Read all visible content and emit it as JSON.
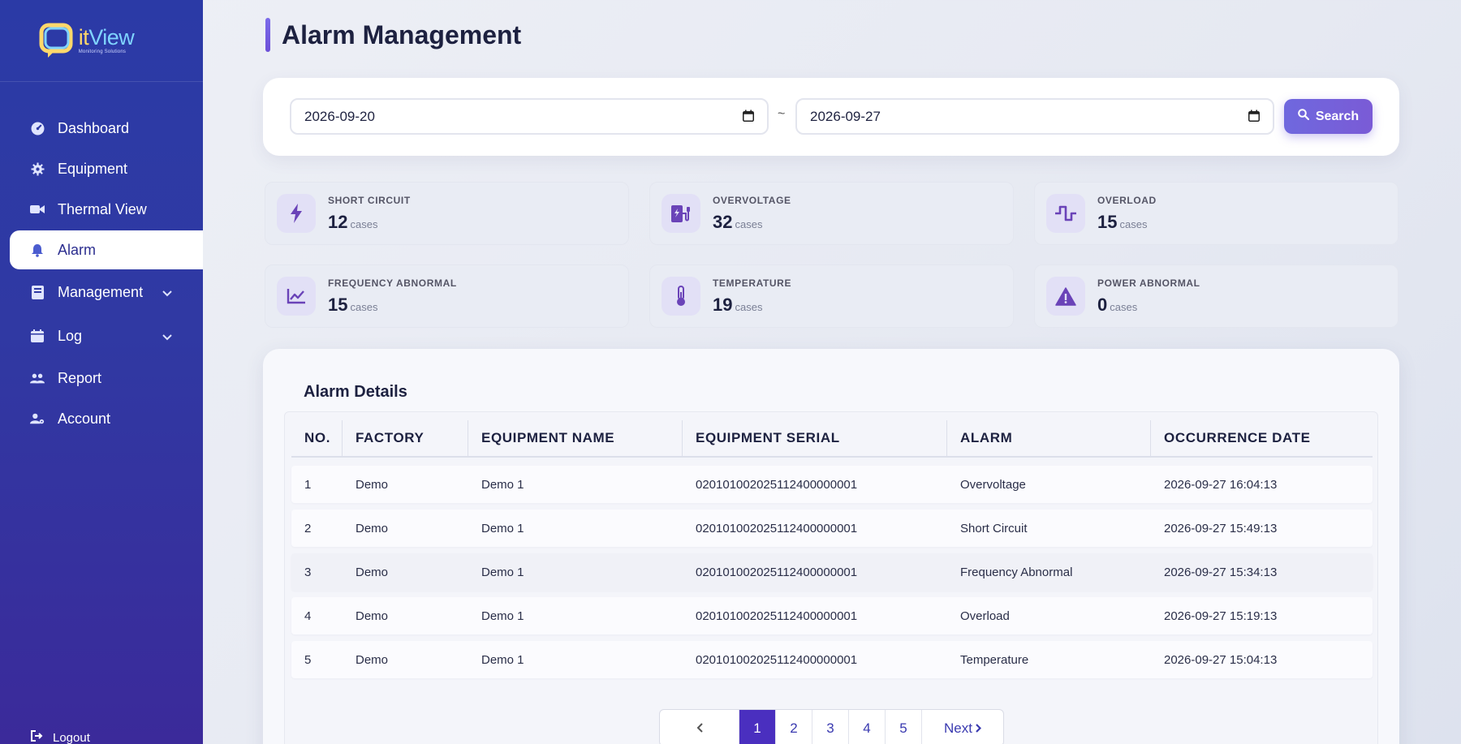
{
  "brand": {
    "name_prefix": "it",
    "name_suffix": "View",
    "tagline": "Monitoring Solutions"
  },
  "sidebar": {
    "items": [
      {
        "label": "Dashboard",
        "icon": "gauge-icon"
      },
      {
        "label": "Equipment",
        "icon": "gear-icon"
      },
      {
        "label": "Thermal View",
        "icon": "video-camera-icon"
      },
      {
        "label": "Alarm",
        "icon": "bell-icon",
        "active": true
      },
      {
        "label": "Management",
        "icon": "book-icon",
        "expandable": true
      },
      {
        "label": "Log",
        "icon": "calendar-icon",
        "expandable": true
      },
      {
        "label": "Report",
        "icon": "users-icon"
      },
      {
        "label": "Account",
        "icon": "user-gear-icon"
      }
    ],
    "logout": "Logout"
  },
  "page": {
    "title": "Alarm Management"
  },
  "filter": {
    "start_date": "2026-09-20",
    "separator": "~",
    "end_date": "2026-09-27",
    "search_label": "Search"
  },
  "stats": [
    {
      "label": "SHORT CIRCUIT",
      "value": "12",
      "unit": "cases",
      "icon": "bolt-icon"
    },
    {
      "label": "OVERVOLTAGE",
      "value": "32",
      "unit": "cases",
      "icon": "charging-station-icon"
    },
    {
      "label": "OVERLOAD",
      "value": "15",
      "unit": "cases",
      "icon": "wave-square-icon"
    },
    {
      "label": "FREQUENCY ABNORMAL",
      "value": "15",
      "unit": "cases",
      "icon": "chart-line-icon"
    },
    {
      "label": "TEMPERATURE",
      "value": "19",
      "unit": "cases",
      "icon": "thermometer-icon"
    },
    {
      "label": "POWER ABNORMAL",
      "value": "0",
      "unit": "cases",
      "icon": "warning-triangle-icon"
    }
  ],
  "table": {
    "title": "Alarm Details",
    "columns": [
      "NO.",
      "FACTORY",
      "EQUIPMENT NAME",
      "EQUIPMENT SERIAL",
      "ALARM",
      "OCCURRENCE DATE"
    ],
    "rows": [
      [
        "1",
        "Demo",
        "Demo 1",
        "020101002025112400000001",
        "Overvoltage",
        "2026-09-27 16:04:13"
      ],
      [
        "2",
        "Demo",
        "Demo 1",
        "020101002025112400000001",
        "Short Circuit",
        "2026-09-27 15:49:13"
      ],
      [
        "3",
        "Demo",
        "Demo 1",
        "020101002025112400000001",
        "Frequency Abnormal",
        "2026-09-27 15:34:13"
      ],
      [
        "4",
        "Demo",
        "Demo 1",
        "020101002025112400000001",
        "Overload",
        "2026-09-27 15:19:13"
      ],
      [
        "5",
        "Demo",
        "Demo 1",
        "020101002025112400000001",
        "Temperature",
        "2026-09-27 15:04:13"
      ]
    ]
  },
  "pagination": {
    "pages": [
      "1",
      "2",
      "3",
      "4",
      "5"
    ],
    "current": "1",
    "next_label": "Next"
  },
  "colors": {
    "accent": "#6f68de",
    "sidebar": "#2b3aa6",
    "active_page": "#4a2fbf"
  }
}
